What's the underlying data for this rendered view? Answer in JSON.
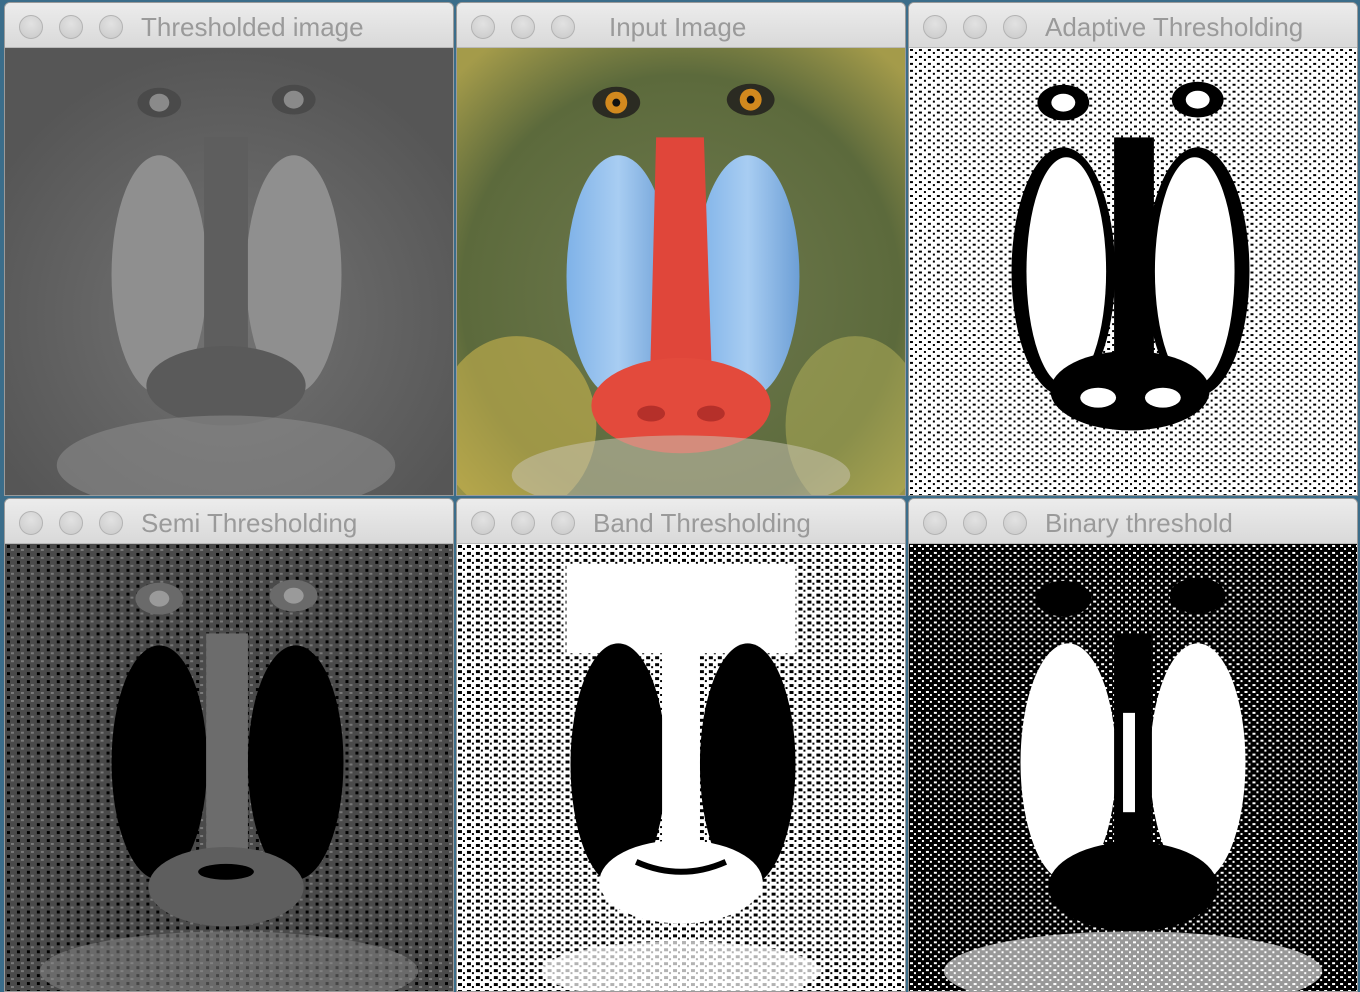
{
  "windows": [
    {
      "title": "Thresholded image"
    },
    {
      "title": "Input Image"
    },
    {
      "title": "Adaptive Thresholding"
    },
    {
      "title": "Semi Thresholding"
    },
    {
      "title": "Band Thresholding"
    },
    {
      "title": "Binary threshold"
    }
  ],
  "icons": {
    "close": "close-light-icon",
    "minimize": "minimize-light-icon",
    "zoom": "zoom-light-icon"
  },
  "colors": {
    "desktop": "#3b6d8a",
    "titlebar": "#e4e4e4",
    "title_text": "#9a9a9a"
  }
}
